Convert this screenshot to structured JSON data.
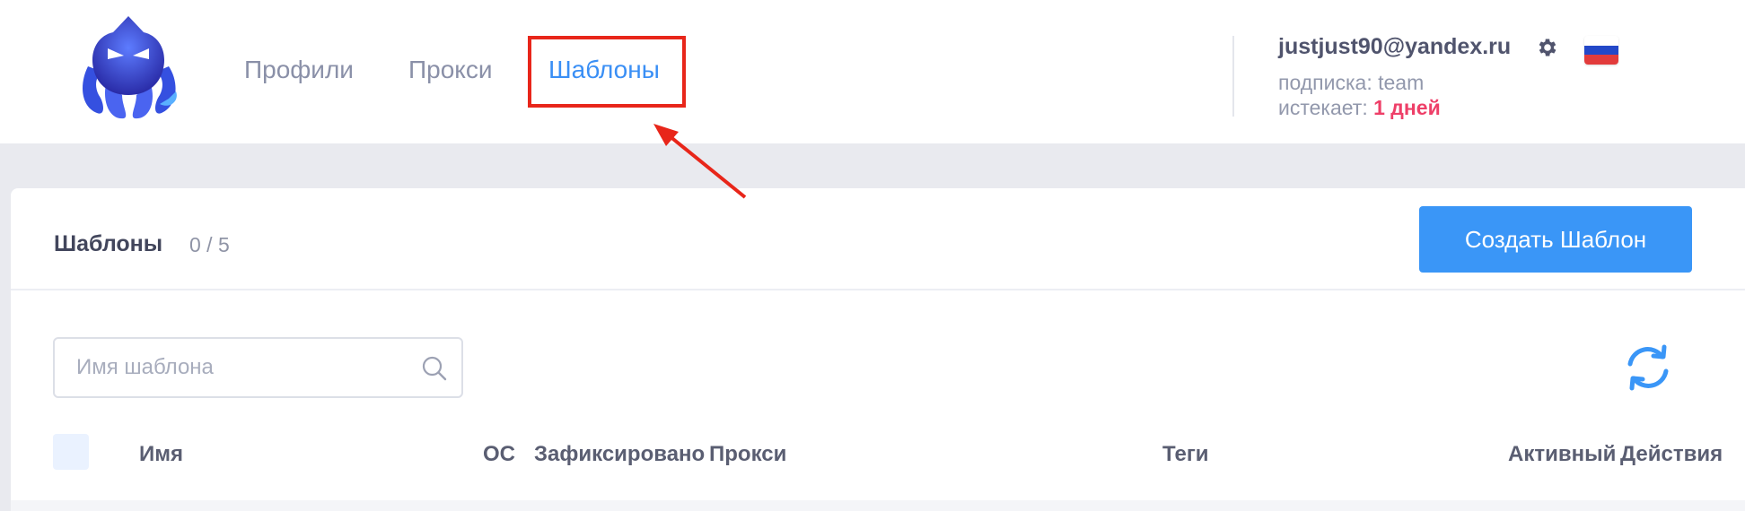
{
  "nav": {
    "items": [
      {
        "label": "Профили"
      },
      {
        "label": "Прокси"
      },
      {
        "label": "Шаблоны"
      }
    ],
    "active_index": 2
  },
  "account": {
    "email": "justjust90@yandex.ru",
    "subscription": "подписка: team",
    "expires_label": "истекает:",
    "expires_value": "1 дней",
    "language_flag": "russia-flag"
  },
  "page": {
    "title": "Шаблоны",
    "count": "0 / 5",
    "create_button_label": "Создать Шаблон"
  },
  "search": {
    "placeholder": "Имя шаблона",
    "value": ""
  },
  "table": {
    "columns": [
      "Имя",
      "ОС",
      "Зафиксировано",
      "Прокси",
      "Теги",
      "Активный",
      "Действия"
    ]
  },
  "colors": {
    "accent": "#3a96f7",
    "highlight": "#e8261a",
    "expires": "#ee3f68"
  },
  "icons": [
    "logo-octopus",
    "gear-icon",
    "search-icon",
    "refresh-icon",
    "russia-flag"
  ]
}
